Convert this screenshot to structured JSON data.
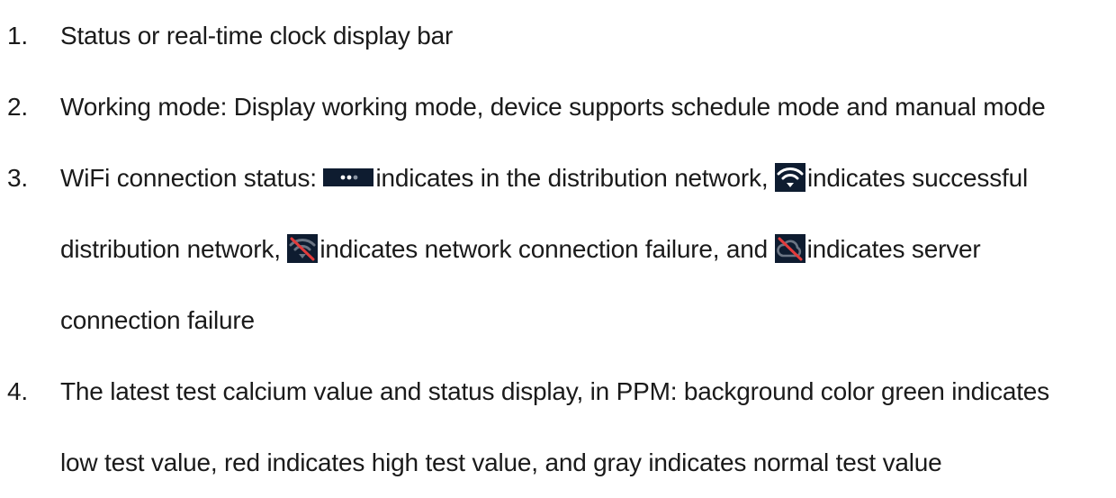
{
  "items": [
    {
      "number": "1.",
      "text": "Status or real-time clock display bar"
    },
    {
      "number": "2.",
      "text": "Working mode: Display working mode, device supports schedule mode and manual mode"
    },
    {
      "number": "3.",
      "prefix": "WiFi connection status: ",
      "seg1": "indicates in the distribution network, ",
      "seg2a": "indicates successful",
      "seg2b": "distribution network, ",
      "seg3": "indicates network connection failure, and ",
      "seg4a": "indicates server",
      "seg4b": "connection failure"
    },
    {
      "number": "4.",
      "line1": "The latest test calcium value and status display, in PPM: background color green indicates",
      "line2": "low test value, red indicates high test value, and gray indicates normal test value"
    }
  ],
  "icons": {
    "distribution": "wifi-connecting-dots-icon",
    "success": "wifi-connected-icon",
    "network_fail": "wifi-disconnected-icon",
    "server_fail": "cloud-disconnected-icon"
  },
  "colors": {
    "text": "#1a1a1a",
    "icon_bg": "#0e1c30",
    "icon_fg": "#ffffff",
    "slash": "#e23b3b"
  }
}
